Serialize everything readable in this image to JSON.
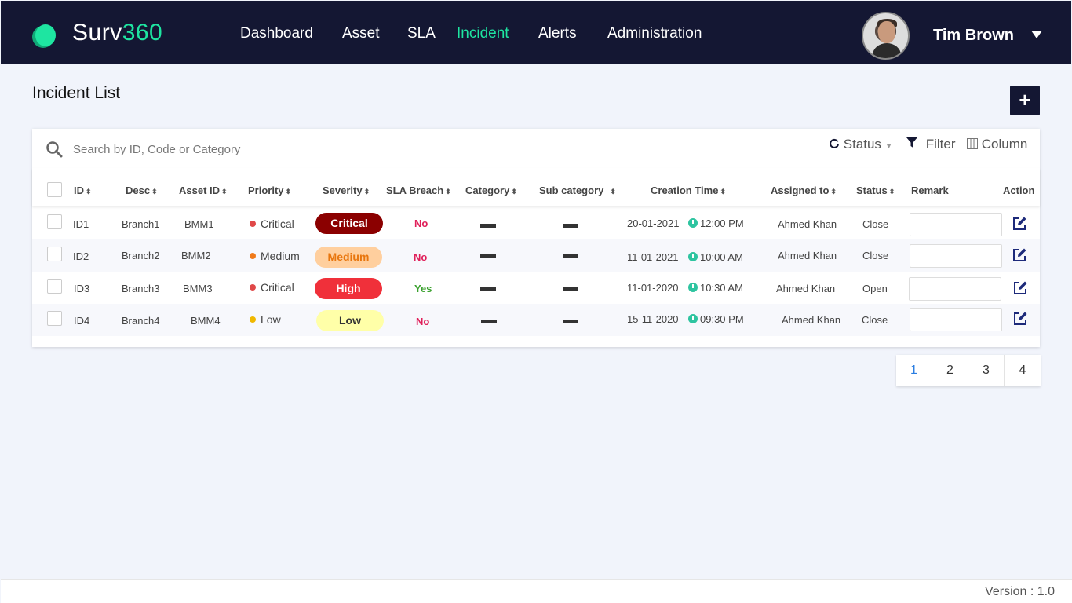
{
  "header": {
    "brand_text": "Surv",
    "brand_num": "360",
    "nav": [
      {
        "label": "Dashboard",
        "active": false
      },
      {
        "label": "Asset",
        "active": false
      },
      {
        "label": "SLA",
        "active": false
      },
      {
        "label": "Incident",
        "active": true
      },
      {
        "label": "Alerts",
        "active": false
      },
      {
        "label": "Administration",
        "active": false
      }
    ],
    "user_name": "Tim Brown",
    "accent_color": "#1ee5a1",
    "bg_color": "#141733"
  },
  "page": {
    "title": "Incident List",
    "add_icon": "+"
  },
  "toolbar": {
    "search_placeholder": "Search by ID, Code or Category",
    "status_label": "Status",
    "filter_label": "Filter",
    "column_label": "Column"
  },
  "table": {
    "columns": [
      "ID",
      "Desc",
      "Asset ID",
      "Priority",
      "Severity",
      "SLA Breach",
      "Category",
      "Sub category",
      "Creation Time",
      "Assigned to",
      "Status",
      "Remark",
      "Action"
    ],
    "rows": [
      {
        "id": "ID1",
        "desc": "Branch1",
        "asset": "BMM1",
        "priority": "Critical",
        "priority_color": "#e04848",
        "severity": "Critical",
        "severity_bg": "#8b0000",
        "severity_fg": "#ffffff",
        "sla": "No",
        "sla_color": "#e0205a",
        "date": "20-01-2021",
        "time": "12:00 PM",
        "assigned": "Ahmed Khan",
        "status": "Close"
      },
      {
        "id": "ID2",
        "desc": "Branch2",
        "asset": "BMM2",
        "priority": "Medium",
        "priority_color": "#f07a1a",
        "severity": "Medium",
        "severity_bg": "#ffcf9e",
        "severity_fg": "#e8760e",
        "sla": "No",
        "sla_color": "#e0205a",
        "date": "11-01-2021",
        "time": "10:00 AM",
        "assigned": "Ahmed Khan",
        "status": "Close"
      },
      {
        "id": "ID3",
        "desc": "Branch3",
        "asset": "BMM3",
        "priority": "Critical",
        "priority_color": "#e04848",
        "severity": "High",
        "severity_bg": "#f0303a",
        "severity_fg": "#ffffff",
        "sla": "Yes",
        "sla_color": "#3aa12e",
        "date": "11-01-2020",
        "time": "10:30 AM",
        "assigned": "Ahmed Khan",
        "status": "Open"
      },
      {
        "id": "ID4",
        "desc": "Branch4",
        "asset": "BMM4",
        "priority": "Low",
        "priority_color": "#f0b800",
        "severity": "Low",
        "severity_bg": "#ffffa8",
        "severity_fg": "#333333",
        "sla": "No",
        "sla_color": "#e0205a",
        "date": "15-11-2020",
        "time": "09:30 PM",
        "assigned": "Ahmed Khan",
        "status": "Close"
      }
    ]
  },
  "pagination": {
    "pages": [
      "1",
      "2",
      "3",
      "4"
    ],
    "current": "1"
  },
  "footer": {
    "version": "Version : 1.0"
  }
}
